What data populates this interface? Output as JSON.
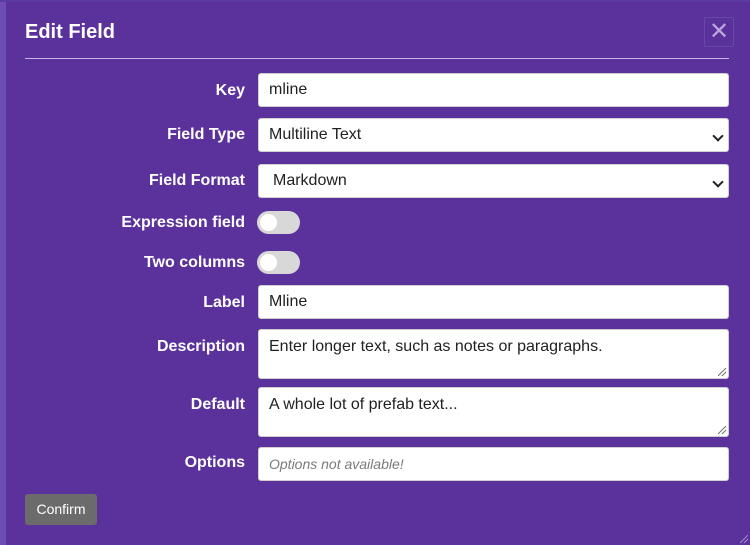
{
  "dialog": {
    "title": "Edit Field",
    "close_glyph": "✕"
  },
  "fields": {
    "key": {
      "label": "Key",
      "value": "mline"
    },
    "field_type": {
      "label": "Field Type",
      "value": "Multiline Text"
    },
    "field_format": {
      "label": "Field Format",
      "value": "Markdown"
    },
    "expression_field": {
      "label": "Expression field",
      "on": false
    },
    "two_columns": {
      "label": "Two columns",
      "on": false
    },
    "label": {
      "label": "Label",
      "value": "Mline"
    },
    "description": {
      "label": "Description",
      "value": "Enter longer text, such as notes or paragraphs."
    },
    "default": {
      "label": "Default",
      "value": "A whole lot of prefab text..."
    },
    "options": {
      "label": "Options",
      "placeholder": "Options not available!"
    }
  },
  "footer": {
    "confirm_label": "Confirm"
  },
  "colors": {
    "dialog_bg": "#5b329c",
    "toggle_off": "#d8d8d8",
    "confirm_bg": "#6b6b6b"
  }
}
